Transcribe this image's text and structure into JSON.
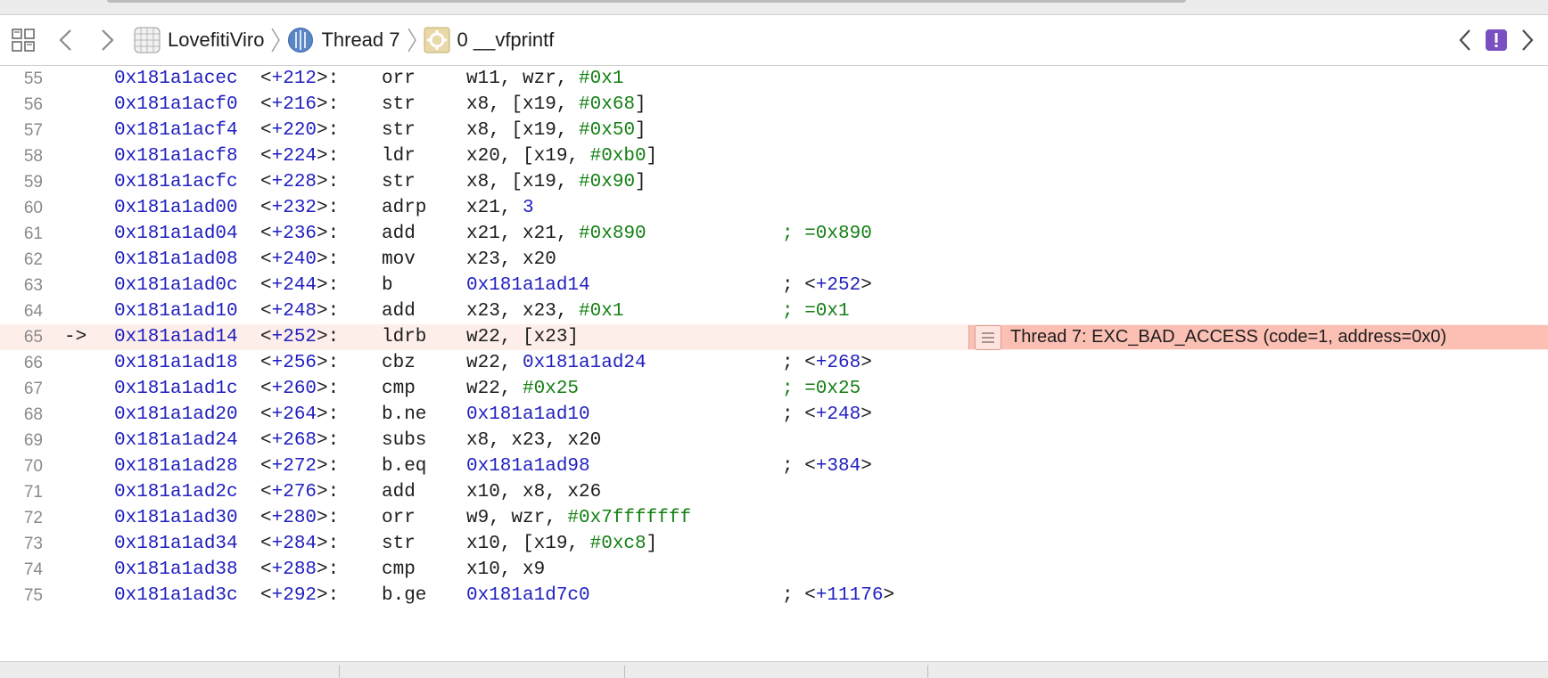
{
  "jumpbar": {
    "crumbs": [
      {
        "label": "LovefitiViro",
        "icon": "app-icon"
      },
      {
        "label": "Thread 7",
        "icon": "thread-icon"
      },
      {
        "label": "0 __vfprintf",
        "icon": "function-gear-icon"
      }
    ],
    "issue_color": "#7a4fc2"
  },
  "rows": [
    {
      "ln": "55",
      "addr": "0x181a1acec",
      "off": "212",
      "mn": "orr",
      "ops": [
        [
          "w11, wzr, ",
          ""
        ],
        [
          "#0x1",
          "imm"
        ]
      ],
      "cmt": null
    },
    {
      "ln": "56",
      "addr": "0x181a1acf0",
      "off": "216",
      "mn": "str",
      "ops": [
        [
          "x8, [x19, ",
          ""
        ],
        [
          "#0x68",
          "imm"
        ],
        [
          "]",
          ""
        ]
      ],
      "cmt": null
    },
    {
      "ln": "57",
      "addr": "0x181a1acf4",
      "off": "220",
      "mn": "str",
      "ops": [
        [
          "x8, [x19, ",
          ""
        ],
        [
          "#0x50",
          "imm"
        ],
        [
          "]",
          ""
        ]
      ],
      "cmt": null
    },
    {
      "ln": "58",
      "addr": "0x181a1acf8",
      "off": "224",
      "mn": "ldr",
      "ops": [
        [
          "x20, [x19, ",
          ""
        ],
        [
          "#0xb0",
          "imm"
        ],
        [
          "]",
          ""
        ]
      ],
      "cmt": null
    },
    {
      "ln": "59",
      "addr": "0x181a1acfc",
      "off": "228",
      "mn": "str",
      "ops": [
        [
          "x8, [x19, ",
          ""
        ],
        [
          "#0x90",
          "imm"
        ],
        [
          "]",
          ""
        ]
      ],
      "cmt": null
    },
    {
      "ln": "60",
      "addr": "0x181a1ad00",
      "off": "232",
      "mn": "adrp",
      "ops": [
        [
          "x21, ",
          ""
        ],
        [
          "3",
          "dec"
        ]
      ],
      "cmt": null
    },
    {
      "ln": "61",
      "addr": "0x181a1ad04",
      "off": "236",
      "mn": "add",
      "ops": [
        [
          "x21, x21, ",
          ""
        ],
        [
          "#0x890",
          "imm"
        ]
      ],
      "cmt": {
        "text": "; =0x890",
        "style": "green"
      }
    },
    {
      "ln": "62",
      "addr": "0x181a1ad08",
      "off": "240",
      "mn": "mov",
      "ops": [
        [
          "x23, x20",
          ""
        ]
      ],
      "cmt": null
    },
    {
      "ln": "63",
      "addr": "0x181a1ad0c",
      "off": "244",
      "mn": "b",
      "ops": [
        [
          "0x181a1ad14",
          "tgt"
        ]
      ],
      "cmt": {
        "text": "252",
        "style": "ref"
      }
    },
    {
      "ln": "64",
      "addr": "0x181a1ad10",
      "off": "248",
      "mn": "add",
      "ops": [
        [
          "x23, x23, ",
          ""
        ],
        [
          "#0x1",
          "imm"
        ]
      ],
      "cmt": {
        "text": "; =0x1",
        "style": "green"
      }
    },
    {
      "ln": "65",
      "addr": "0x181a1ad14",
      "off": "252",
      "mn": "ldrb",
      "ops": [
        [
          "w22, [x23]",
          ""
        ]
      ],
      "cmt": null,
      "current": true,
      "arrow": "->",
      "banner": "Thread 7: EXC_BAD_ACCESS (code=1, address=0x0)"
    },
    {
      "ln": "66",
      "addr": "0x181a1ad18",
      "off": "256",
      "mn": "cbz",
      "ops": [
        [
          "w22, ",
          ""
        ],
        [
          "0x181a1ad24",
          "tgt"
        ]
      ],
      "cmt": {
        "text": "268",
        "style": "ref"
      }
    },
    {
      "ln": "67",
      "addr": "0x181a1ad1c",
      "off": "260",
      "mn": "cmp",
      "ops": [
        [
          "w22, ",
          ""
        ],
        [
          "#0x25",
          "imm"
        ]
      ],
      "cmt": {
        "text": "; =0x25",
        "style": "green"
      }
    },
    {
      "ln": "68",
      "addr": "0x181a1ad20",
      "off": "264",
      "mn": "b.ne",
      "ops": [
        [
          "0x181a1ad10",
          "tgt"
        ]
      ],
      "cmt": {
        "text": "248",
        "style": "ref"
      }
    },
    {
      "ln": "69",
      "addr": "0x181a1ad24",
      "off": "268",
      "mn": "subs",
      "ops": [
        [
          "x8, x23, x20",
          ""
        ]
      ],
      "cmt": null
    },
    {
      "ln": "70",
      "addr": "0x181a1ad28",
      "off": "272",
      "mn": "b.eq",
      "ops": [
        [
          "0x181a1ad98",
          "tgt"
        ]
      ],
      "cmt": {
        "text": "384",
        "style": "ref"
      }
    },
    {
      "ln": "71",
      "addr": "0x181a1ad2c",
      "off": "276",
      "mn": "add",
      "ops": [
        [
          "x10, x8, x26",
          ""
        ]
      ],
      "cmt": null
    },
    {
      "ln": "72",
      "addr": "0x181a1ad30",
      "off": "280",
      "mn": "orr",
      "ops": [
        [
          "w9, wzr, ",
          ""
        ],
        [
          "#0x7fffffff",
          "imm"
        ]
      ],
      "cmt": null
    },
    {
      "ln": "73",
      "addr": "0x181a1ad34",
      "off": "284",
      "mn": "str",
      "ops": [
        [
          "x10, [x19, ",
          ""
        ],
        [
          "#0xc8",
          "imm"
        ],
        [
          "]",
          ""
        ]
      ],
      "cmt": null
    },
    {
      "ln": "74",
      "addr": "0x181a1ad38",
      "off": "288",
      "mn": "cmp",
      "ops": [
        [
          "x10, x9",
          ""
        ]
      ],
      "cmt": null
    },
    {
      "ln": "75",
      "addr": "0x181a1ad3c",
      "off": "292",
      "mn": "b.ge",
      "ops": [
        [
          "0x181a1d7c0",
          "tgt"
        ]
      ],
      "cmt": {
        "text": "11176",
        "style": "ref"
      }
    }
  ]
}
